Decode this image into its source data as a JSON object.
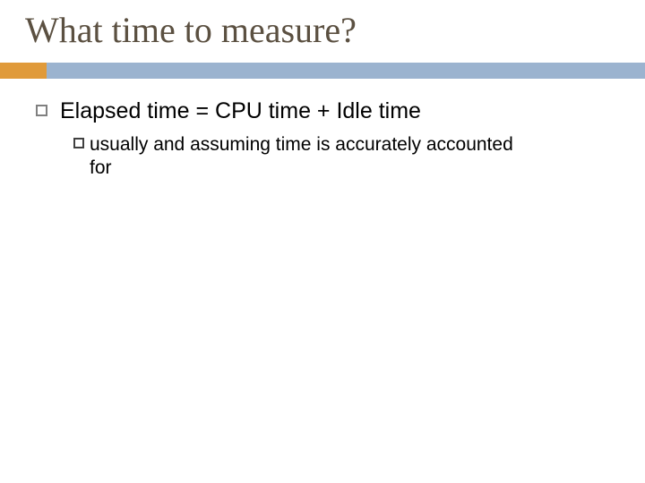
{
  "colors": {
    "accent": "#e09a3a",
    "bar": "#9bb3cf",
    "title": "#5b5041"
  },
  "title": "What time to measure?",
  "bullets": [
    {
      "text": "Elapsed time = CPU time + Idle time",
      "children": [
        {
          "text": "usually and assuming time is accurately accounted for"
        }
      ]
    }
  ]
}
